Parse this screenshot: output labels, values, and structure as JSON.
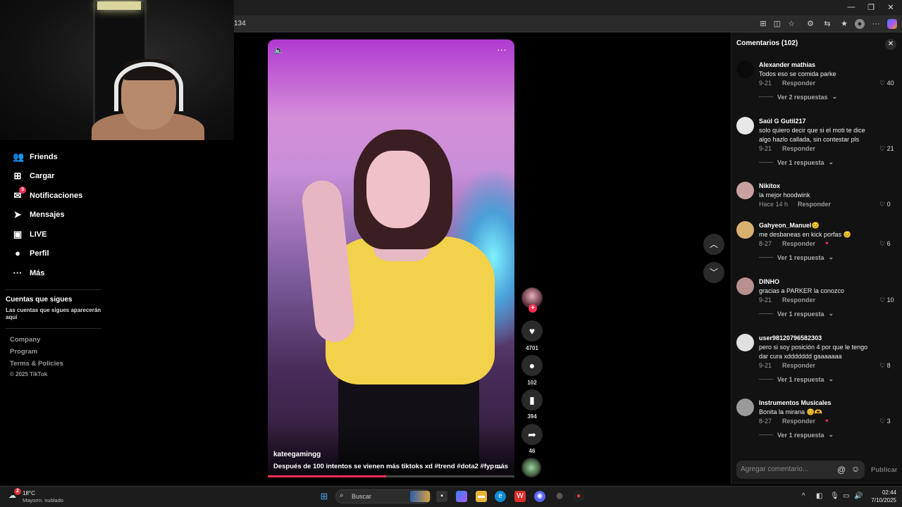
{
  "browser": {
    "url_fragment": "134"
  },
  "sidebar": {
    "items": [
      {
        "label": "Friends",
        "icon": "friends-icon",
        "glyph": "👥"
      },
      {
        "label": "Cargar",
        "icon": "upload-icon",
        "glyph": "⊞"
      },
      {
        "label": "Notificaciones",
        "icon": "inbox-icon",
        "glyph": "✉",
        "badge": "3"
      },
      {
        "label": "Mensajes",
        "icon": "send-icon",
        "glyph": "➤"
      },
      {
        "label": "LIVE",
        "icon": "live-icon",
        "glyph": "▣"
      },
      {
        "label": "Perfil",
        "icon": "profile-icon",
        "glyph": "●"
      },
      {
        "label": "Más",
        "icon": "more-icon",
        "glyph": "···"
      }
    ],
    "following_title": "Cuentas que sigues",
    "following_desc": "Las cuentas que sigues aparecerán aquí",
    "footer_links": [
      "Company",
      "Program",
      "Terms & Policies"
    ],
    "copyright": "© 2025 TikTok"
  },
  "video": {
    "author": "kateegamingg",
    "caption": "Después de 100 intentos se vienen más tiktoks xd #trend  #dota2  #fyp  ...",
    "caption_more": "más",
    "progress": 0.48
  },
  "actions": {
    "likes": "4701",
    "comments": "102",
    "saves": "394",
    "shares": "46"
  },
  "comments_panel": {
    "title": "Comentarios (102)",
    "input_placeholder": "Agregar comentario...",
    "publish_label": "Publicar",
    "reply_label": "Responder",
    "items": [
      {
        "name": "Alexander mathias",
        "text": "Todos eso se comida parke",
        "date": "9-21",
        "likes": "40",
        "more": "Ver 2 respuestas"
      },
      {
        "name": "Saúl G Gutil217",
        "text": "solo quiero decir que si el moti te dice algo hazlo callada, sin contestar pls",
        "date": "9-21",
        "likes": "21",
        "more": "Ver 1 respuesta"
      },
      {
        "name": "Nikitox",
        "text": "la mejor hoodwink",
        "date": "Hace 14 h",
        "likes": "0",
        "more": ""
      },
      {
        "name": "Gahyeon_Manuel😊",
        "text": "me desbaneas en kick porfas 😊",
        "date": "8-27",
        "likes": "6",
        "more": "Ver 1 respuesta"
      },
      {
        "name": "DINHO",
        "text": "gracias a PARKER la conozco",
        "date": "9-21",
        "likes": "10",
        "more": "Ver 1 respuesta"
      },
      {
        "name": "user98120796582303",
        "text": "pero si soy posición 4 por que le tengo dar cura xddddddd gaaaaaaa",
        "date": "9-21",
        "likes": "8",
        "more": "Ver 1 respuesta"
      },
      {
        "name": "Instrumentos Musicales",
        "text": "Bonita la mirana 😊🫶",
        "date": "8-27",
        "likes": "3",
        "more": "Ver 1 respuesta"
      }
    ]
  },
  "taskbar": {
    "temperature": "18°C",
    "weather": "Mayorm. nublado",
    "weather_badge": "2",
    "search_label": "Buscar",
    "time": "02:44",
    "date": "7/10/2025"
  },
  "colors": {
    "accent": "#fe2c55",
    "panel": "#121212"
  }
}
